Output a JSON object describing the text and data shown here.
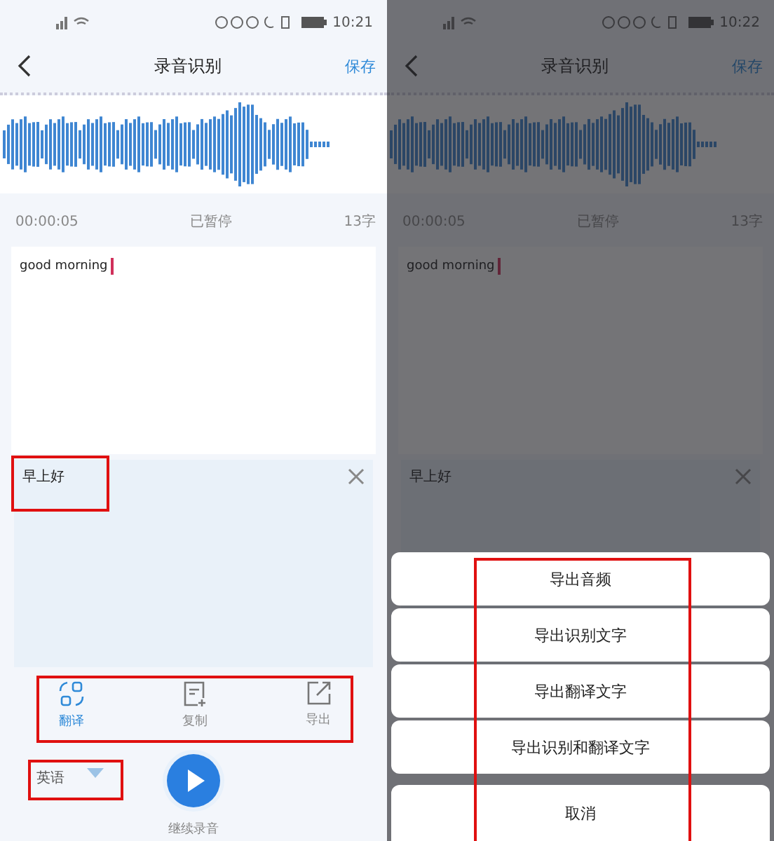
{
  "screens": [
    {
      "status_bar": {
        "time": "10:21"
      },
      "header": {
        "title": "录音识别",
        "action": "保存"
      },
      "info": {
        "elapsed": "00:00:05",
        "state": "已暂停",
        "count": "13字"
      },
      "transcript": {
        "text": "good morning"
      },
      "translation": {
        "text": "早上好",
        "highlighted": true
      },
      "toolbar": {
        "highlighted": true,
        "items": [
          {
            "kind": "translate",
            "label": "翻译",
            "selected": true
          },
          {
            "kind": "copy",
            "label": "复制",
            "selected": false
          },
          {
            "kind": "export",
            "label": "导出",
            "selected": false
          }
        ]
      },
      "language": {
        "label": "英语",
        "highlighted": true
      },
      "resume_label": "继续录音"
    },
    {
      "status_bar": {
        "time": "10:22"
      },
      "header": {
        "title": "录音识别",
        "action": "保存"
      },
      "info": {
        "elapsed": "00:00:05",
        "state": "已暂停",
        "count": "13字"
      },
      "transcript": {
        "text": "good morning"
      },
      "translation": {
        "text": "早上好",
        "highlighted": false
      },
      "action_sheet": {
        "highlighted": true,
        "options": [
          "导出音频",
          "导出识别文字",
          "导出翻译文字",
          "导出识别和翻译文字"
        ],
        "cancel": "取消"
      }
    }
  ]
}
